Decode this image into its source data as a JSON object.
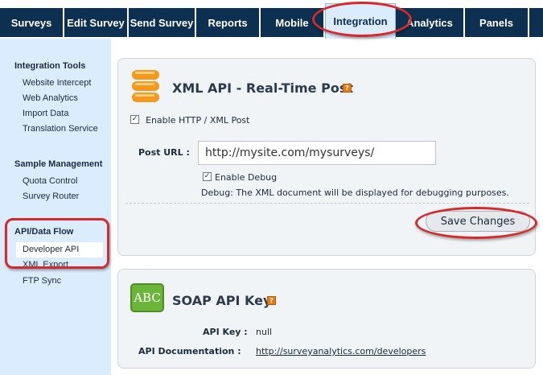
{
  "nav": {
    "tabs": [
      {
        "label": "Surveys"
      },
      {
        "label": "Edit Survey"
      },
      {
        "label": "Send Survey"
      },
      {
        "label": "Reports"
      },
      {
        "label": "Mobile"
      },
      {
        "label": "Integration",
        "active": true
      },
      {
        "label": "Analytics"
      },
      {
        "label": "Panels"
      }
    ]
  },
  "sidebar": {
    "sections": [
      {
        "title": "Integration Tools",
        "items": [
          "Website Intercept",
          "Web Analytics",
          "Import Data",
          "Translation Service"
        ]
      },
      {
        "title": "Sample Management",
        "items": [
          "Quota Control",
          "Survey Router"
        ]
      },
      {
        "title": "API/Data Flow",
        "items": [
          "Developer API",
          "XML Export",
          "FTP Sync"
        ],
        "selected": "Developer API"
      }
    ]
  },
  "xml_api": {
    "title": "XML API - Real-Time Post",
    "enable_http_label": "Enable HTTP / XML Post",
    "enable_http_checked": true,
    "post_url_label": "Post URL :",
    "post_url_value": "http://mysite.com/mysurveys/",
    "enable_debug_label": "Enable Debug",
    "enable_debug_checked": true,
    "debug_note": "Debug: The XML document will be displayed for debugging purposes.",
    "save_label": "Save Changes"
  },
  "soap_api": {
    "title": "SOAP API Key",
    "icon_text": "ABC",
    "api_key_label": "API Key :",
    "api_key_value": "null",
    "doc_label": "API Documentation :",
    "doc_link": "http://surveyanalytics.com/developers"
  },
  "colors": {
    "nav_bg": "#0d2f50",
    "active_tab_bg": "#dcecff",
    "sidebar_bg": "#dcecff",
    "highlight_oval": "#d52a2a",
    "xml_icon": "#f39a1e",
    "soap_icon": "#6bb63a"
  },
  "icons": {
    "xml_api": "stack-icon",
    "soap_api": "abc-icon",
    "help": "help-icon"
  }
}
